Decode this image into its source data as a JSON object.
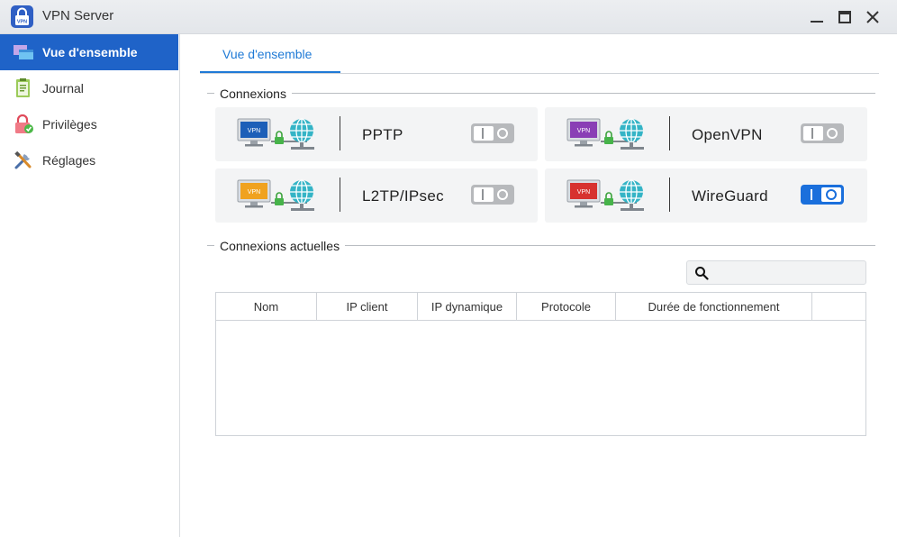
{
  "window": {
    "title": "VPN Server",
    "app_icon_text": "VPN"
  },
  "sidebar": {
    "items": [
      {
        "label": "Vue d'ensemble",
        "icon": "overview-icon",
        "active": true
      },
      {
        "label": "Journal",
        "icon": "journal-icon",
        "active": false
      },
      {
        "label": "Privilèges",
        "icon": "privileges-icon",
        "active": false
      },
      {
        "label": "Réglages",
        "icon": "settings-icon",
        "active": false
      }
    ]
  },
  "tabs": [
    {
      "label": "Vue d'ensemble",
      "active": true
    }
  ],
  "connections": {
    "title": "Connexions",
    "items": [
      {
        "name": "PPTP",
        "badge": "VPN",
        "monitor_color": "#1d5fb8",
        "enabled": false
      },
      {
        "name": "OpenVPN",
        "badge": "VPN",
        "monitor_color": "#8a3fb5",
        "enabled": false
      },
      {
        "name": "L2TP/IPsec",
        "badge": "VPN",
        "monitor_color": "#f0a21f",
        "enabled": false
      },
      {
        "name": "WireGuard",
        "badge": "VPN",
        "monitor_color": "#d7322f",
        "enabled": true
      }
    ]
  },
  "current_connections": {
    "title": "Connexions actuelles",
    "search_placeholder": "",
    "columns": [
      "Nom",
      "IP client",
      "IP dynamique",
      "Protocole",
      "Durée de fonctionnement",
      ""
    ],
    "rows": []
  },
  "colors": {
    "accent": "#1f63c8",
    "tab_accent": "#1f7ad6",
    "toggle_on": "#1a6fdc",
    "toggle_off": "#b7b9bc"
  }
}
